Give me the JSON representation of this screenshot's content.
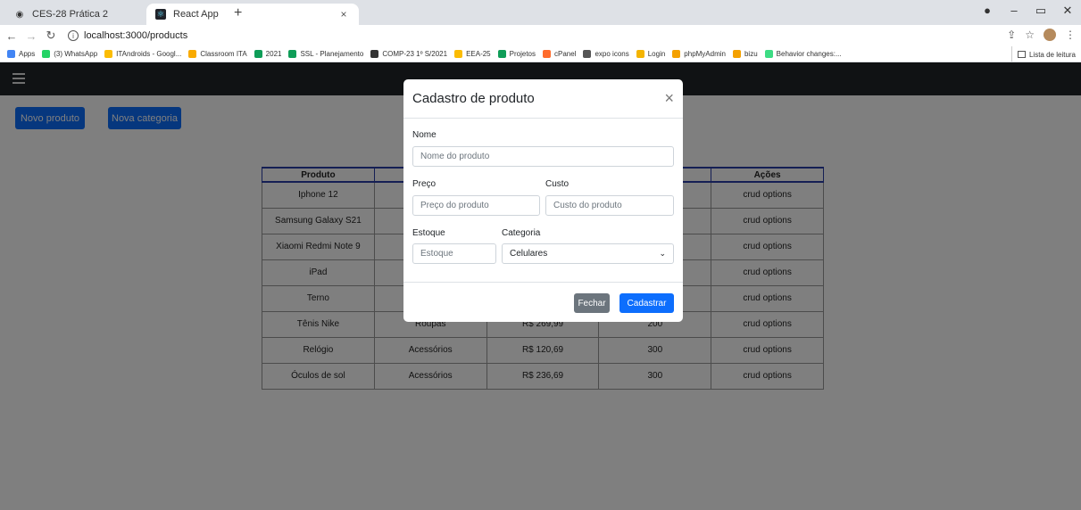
{
  "browser": {
    "tabs": [
      {
        "title": "CES-28 Prática 2",
        "close": "×"
      },
      {
        "title": "React App",
        "close": "×"
      }
    ],
    "new_tab": "+",
    "url": "localhost:3000/products",
    "info_glyph": "i",
    "window_controls": {
      "minimize": "–",
      "maximize": "▭",
      "close": "✕"
    },
    "bookmarks": [
      {
        "label": "Apps",
        "color": "#4285f4"
      },
      {
        "label": "(3) WhatsApp",
        "color": "#25d366"
      },
      {
        "label": "ITAndroids - Googl...",
        "color": "#fbbc04"
      },
      {
        "label": "Classroom ITA",
        "color": "#f9ab00"
      },
      {
        "label": "2021",
        "color": "#0f9d58"
      },
      {
        "label": "SSL - Planejamento",
        "color": "#0f9d58"
      },
      {
        "label": "COMP-23 1º S/2021",
        "color": "#333333"
      },
      {
        "label": "EEA-25",
        "color": "#fbbc04"
      },
      {
        "label": "Projetos",
        "color": "#0f9d58"
      },
      {
        "label": "cPanel",
        "color": "#ff6c2c"
      },
      {
        "label": "expo icons",
        "color": "#555555"
      },
      {
        "label": "Login",
        "color": "#f4b400"
      },
      {
        "label": "phpMyAdmin",
        "color": "#f4a100"
      },
      {
        "label": "bizu",
        "color": "#f4a100"
      },
      {
        "label": "Behavior changes:...",
        "color": "#3ddc84"
      }
    ],
    "reading_list": "Lista de leitura"
  },
  "app": {
    "buttons": {
      "new_product": "Novo produto",
      "new_category": "Nova categoria"
    },
    "table": {
      "headers": [
        "Produto",
        "",
        "",
        "",
        "Ações"
      ],
      "rows": [
        [
          "Iphone 12",
          "",
          "",
          "",
          "crud options"
        ],
        [
          "Samsung Galaxy S21",
          "",
          "",
          "",
          "crud options"
        ],
        [
          "Xiaomi Redmi Note 9",
          "",
          "",
          "",
          "crud options"
        ],
        [
          "iPad",
          "",
          "",
          "",
          "crud options"
        ],
        [
          "Terno",
          "",
          "",
          "",
          "crud options"
        ],
        [
          "Tênis Nike",
          "Roupas",
          "R$ 269,99",
          "200",
          "crud options"
        ],
        [
          "Relógio",
          "Acessórios",
          "R$ 120,69",
          "300",
          "crud options"
        ],
        [
          "Óculos de sol",
          "Acessórios",
          "R$ 236,69",
          "300",
          "crud options"
        ]
      ]
    }
  },
  "modal": {
    "title": "Cadastro de produto",
    "close": "×",
    "fields": {
      "nome": {
        "label": "Nome",
        "placeholder": "Nome do produto"
      },
      "preco": {
        "label": "Preço",
        "placeholder": "Preço do produto"
      },
      "custo": {
        "label": "Custo",
        "placeholder": "Custo do produto"
      },
      "estoque": {
        "label": "Estoque",
        "placeholder": "Estoque"
      },
      "categoria": {
        "label": "Categoria",
        "value": "Celulares"
      }
    },
    "buttons": {
      "close": "Fechar",
      "submit": "Cadastrar"
    }
  }
}
